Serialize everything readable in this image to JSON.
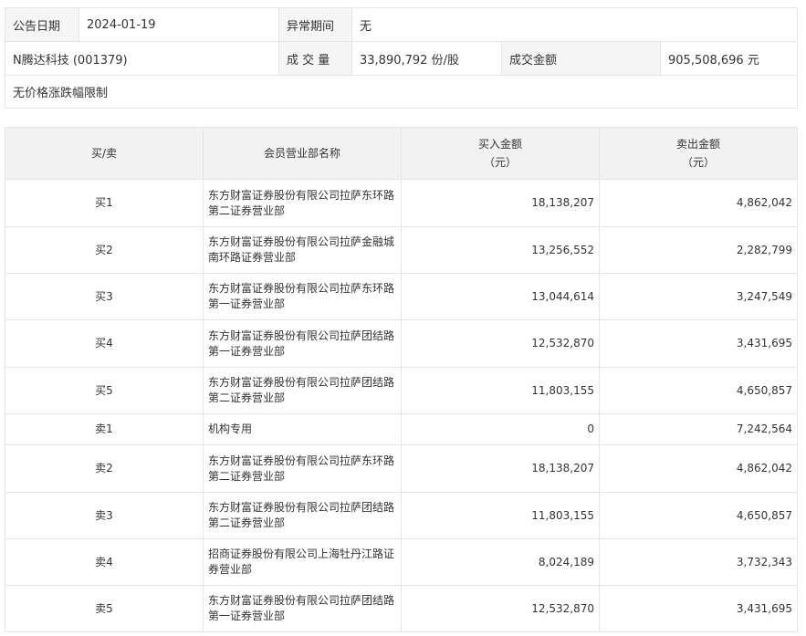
{
  "summary": {
    "announce_date_label": "公告日期",
    "announce_date_value": "2024-01-19",
    "abnormal_period_label": "异常期间",
    "abnormal_period_value": "无",
    "stock_name": "N腾达科技 (001379)",
    "volume_label": "成 交 量",
    "volume_value": "33,890,792 份/股",
    "amount_label": "成交金额",
    "amount_value": "905,508,696 元",
    "note": "无价格涨跌幅限制"
  },
  "table": {
    "headers": {
      "side": "买/卖",
      "broker": "会员营业部名称",
      "buy_amount": "买入金额",
      "buy_unit": "（元）",
      "sell_amount": "卖出金额",
      "sell_unit": "（元）"
    },
    "rows": [
      {
        "side": "买1",
        "broker_line1": "东方财富证券股份有限公司拉萨东环路",
        "broker_line2": "第二证券营业部",
        "buy": "18,138,207",
        "sell": "4,862,042"
      },
      {
        "side": "买2",
        "broker_line1": "东方财富证券股份有限公司拉萨金融城",
        "broker_line2": "南环路证券营业部",
        "buy": "13,256,552",
        "sell": "2,282,799"
      },
      {
        "side": "买3",
        "broker_line1": "东方财富证券股份有限公司拉萨东环路",
        "broker_line2": "第一证券营业部",
        "buy": "13,044,614",
        "sell": "3,247,549"
      },
      {
        "side": "买4",
        "broker_line1": "东方财富证券股份有限公司拉萨团结路",
        "broker_line2": "第一证券营业部",
        "buy": "12,532,870",
        "sell": "3,431,695"
      },
      {
        "side": "买5",
        "broker_line1": "东方财富证券股份有限公司拉萨团结路",
        "broker_line2": "第二证券营业部",
        "buy": "11,803,155",
        "sell": "4,650,857"
      },
      {
        "side": "卖1",
        "broker_line1": "机构专用",
        "broker_line2": "",
        "buy": "0",
        "sell": "7,242,564"
      },
      {
        "side": "卖2",
        "broker_line1": "东方财富证券股份有限公司拉萨东环路",
        "broker_line2": "第二证券营业部",
        "buy": "18,138,207",
        "sell": "4,862,042"
      },
      {
        "side": "卖3",
        "broker_line1": "东方财富证券股份有限公司拉萨团结路",
        "broker_line2": "第二证券营业部",
        "buy": "11,803,155",
        "sell": "4,650,857"
      },
      {
        "side": "卖4",
        "broker_line1": "招商证券股份有限公司上海牡丹江路证",
        "broker_line2": "券营业部",
        "buy": "8,024,189",
        "sell": "3,732,343"
      },
      {
        "side": "卖5",
        "broker_line1": "东方财富证券股份有限公司拉萨团结路",
        "broker_line2": "第一证券营业部",
        "buy": "12,532,870",
        "sell": "3,431,695"
      }
    ]
  }
}
